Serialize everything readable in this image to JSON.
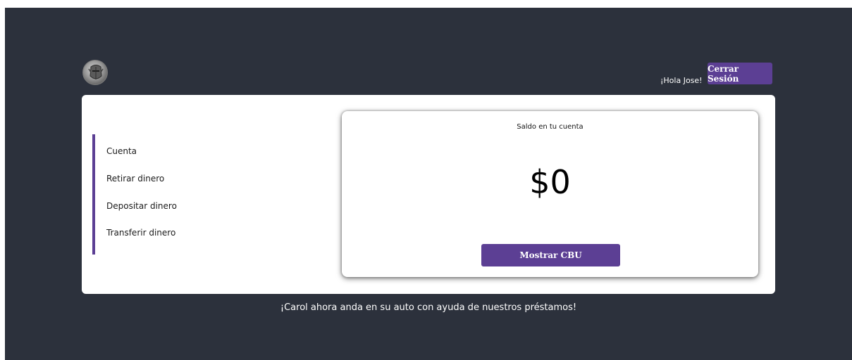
{
  "header": {
    "logo_icon": "knight-helmet-logo-icon",
    "greeting": "¡Hola Jose!",
    "logout_label": "Cerrar Sesión"
  },
  "sidebar": {
    "items": [
      {
        "label": "Cuenta"
      },
      {
        "label": "Retirar dinero"
      },
      {
        "label": "Depositar dinero"
      },
      {
        "label": "Transferir dinero"
      }
    ]
  },
  "balance": {
    "title": "Saldo en tu cuenta",
    "amount": "$0",
    "cbu_button_label": "Mostrar CBU"
  },
  "promo": {
    "text": "¡Carol ahora anda en su auto con ayuda de nuestros préstamos!"
  },
  "colors": {
    "background": "#2c313c",
    "accent": "#5c3f94",
    "card": "#ffffff"
  }
}
